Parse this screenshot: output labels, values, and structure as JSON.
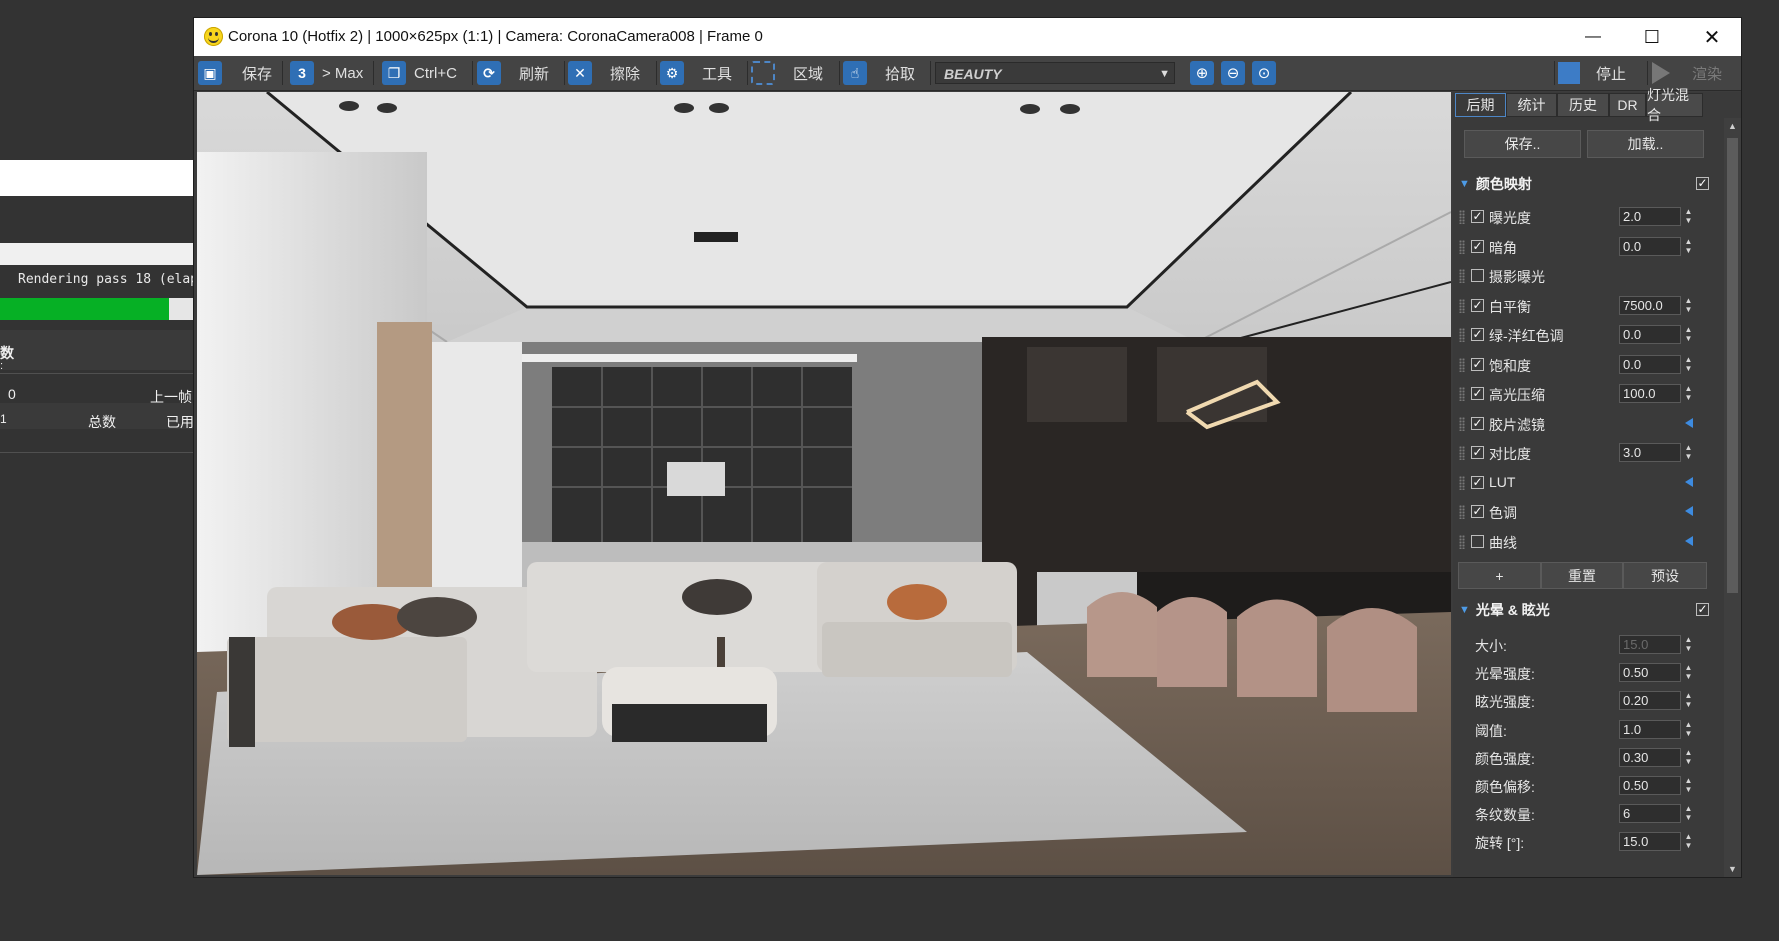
{
  "background_window": {
    "status_text": "Rendering pass 18 (elap",
    "progress": 0.87,
    "section_label": "数",
    "colon": ":",
    "value_zero": "0",
    "prev_frame": "上一帧",
    "total": "总数",
    "used": "已用",
    "index": "1"
  },
  "window": {
    "title": "Corona 10 (Hotfix 2) | 1000×625px (1:1) | Camera: CoronaCamera008 | Frame 0",
    "minimize": "—",
    "maximize": "☐",
    "close": "✕"
  },
  "toolbar": {
    "save": "保存",
    "to_max": "> Max",
    "copy": "Ctrl+C",
    "refresh": "刷新",
    "clear": "擦除",
    "tools": "工具",
    "region": "区域",
    "pick": "拾取",
    "render_element": "BEAUTY",
    "stop": "停止",
    "render": "渲染",
    "max_icon_text": "3"
  },
  "panel": {
    "tabs": [
      "后期",
      "统计",
      "历史",
      "DR",
      "灯光混合"
    ],
    "save_btn": "保存..",
    "load_btn": "加载..",
    "tone_mapping": {
      "title": "颜色映射",
      "rows": [
        {
          "label": "曝光度",
          "checked": true,
          "value": "2.0"
        },
        {
          "label": "暗角",
          "checked": true,
          "value": "0.0"
        },
        {
          "label": "摄影曝光",
          "checked": false,
          "value": null
        },
        {
          "label": "白平衡",
          "checked": true,
          "value": "7500.0"
        },
        {
          "label": "绿-洋红色调",
          "checked": true,
          "value": "0.0"
        },
        {
          "label": "饱和度",
          "checked": true,
          "value": "0.0"
        },
        {
          "label": "高光压缩",
          "checked": true,
          "value": "100.0"
        },
        {
          "label": "胶片滤镜",
          "checked": true,
          "value": null,
          "expand": true
        },
        {
          "label": "对比度",
          "checked": true,
          "value": "3.0"
        },
        {
          "label": "LUT",
          "checked": true,
          "value": null,
          "expand": true
        },
        {
          "label": "色调",
          "checked": true,
          "value": null,
          "expand": true
        },
        {
          "label": "曲线",
          "checked": false,
          "value": null,
          "expand": true
        }
      ],
      "add_btn": "+",
      "reset_btn": "重置",
      "preset_btn": "预设"
    },
    "bloom_glare": {
      "title": "光晕 & 眩光",
      "rows": [
        {
          "label": "大小:",
          "value": "15.0",
          "disabled": true
        },
        {
          "label": "光晕强度:",
          "value": "0.50"
        },
        {
          "label": "眩光强度:",
          "value": "0.20"
        },
        {
          "label": "阈值:",
          "value": "1.0"
        },
        {
          "label": "颜色强度:",
          "value": "0.30"
        },
        {
          "label": "颜色偏移:",
          "value": "0.50"
        },
        {
          "label": "条纹数量:",
          "value": "6"
        },
        {
          "label": "旋转 [°]:",
          "value": "15.0"
        }
      ]
    }
  },
  "colors": {
    "accent_blue": "#2f6fb5",
    "progress_green": "#06b025",
    "panel_bg": "#3a3a3a"
  }
}
